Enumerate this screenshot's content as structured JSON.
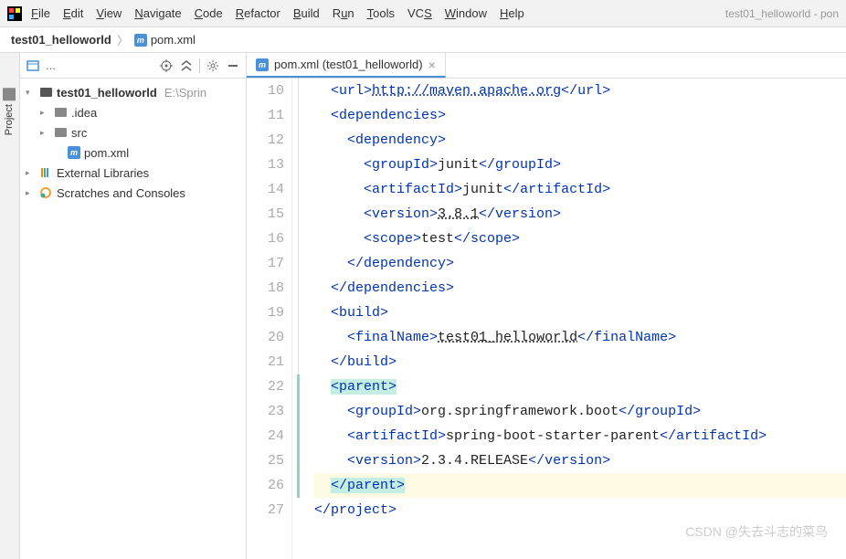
{
  "menu": {
    "items": [
      "File",
      "Edit",
      "View",
      "Navigate",
      "Code",
      "Refactor",
      "Build",
      "Run",
      "Tools",
      "VCS",
      "Window",
      "Help"
    ],
    "underlines": [
      "F",
      "E",
      "V",
      "N",
      "C",
      "R",
      "B",
      "u",
      "T",
      "S",
      "W",
      "H"
    ]
  },
  "window_title": "test01_helloworld - pon",
  "breadcrumb": {
    "project": "test01_helloworld",
    "file": "pom.xml"
  },
  "sidebar_tab": "Project",
  "project_toolbar": {
    "dots": "..."
  },
  "tree": {
    "root": {
      "label": "test01_helloworld",
      "path": "E:\\Sprin"
    },
    "idea": ".idea",
    "src": "src",
    "pom": "pom.xml",
    "external": "External Libraries",
    "scratches": "Scratches and Consoles"
  },
  "tab": {
    "label": "pom.xml (test01_helloworld)"
  },
  "code": {
    "lines": [
      {
        "n": 10,
        "html": "  <span class='tag'>&lt;url&gt;</span><span class='link'>http://maven.apache.org</span><span class='tag'>&lt;/url&gt;</span>"
      },
      {
        "n": 11,
        "html": "  <span class='tag'>&lt;dependencies&gt;</span>"
      },
      {
        "n": 12,
        "html": "    <span class='tag'>&lt;dependency&gt;</span>"
      },
      {
        "n": 13,
        "html": "      <span class='tag'>&lt;groupId&gt;</span><span class='txt'>junit</span><span class='tag'>&lt;/groupId&gt;</span>"
      },
      {
        "n": 14,
        "html": "      <span class='tag'>&lt;artifactId&gt;</span><span class='txt'>junit</span><span class='tag'>&lt;/artifactId&gt;</span>"
      },
      {
        "n": 15,
        "html": "      <span class='tag'>&lt;version&gt;</span><span class='val'>3.8.1</span><span class='tag'>&lt;/version&gt;</span>"
      },
      {
        "n": 16,
        "html": "      <span class='tag'>&lt;scope&gt;</span><span class='txt'>test</span><span class='tag'>&lt;/scope&gt;</span>"
      },
      {
        "n": 17,
        "html": "    <span class='tag'>&lt;/dependency&gt;</span>"
      },
      {
        "n": 18,
        "html": "  <span class='tag'>&lt;/dependencies&gt;</span>"
      },
      {
        "n": 19,
        "html": "  <span class='tag'>&lt;build&gt;</span>"
      },
      {
        "n": 20,
        "html": "    <span class='tag'>&lt;finalName&gt;</span><span class='val'>test01_helloworld</span><span class='tag'>&lt;/finalName&gt;</span>"
      },
      {
        "n": 21,
        "html": "  <span class='tag'>&lt;/build&gt;</span>"
      },
      {
        "n": 22,
        "html": "  <span class='hl-bg'><span class='tag'>&lt;parent&gt;</span></span>"
      },
      {
        "n": 23,
        "html": "    <span class='tag'>&lt;groupId&gt;</span><span class='txt'>org.springframework.boot</span><span class='tag'>&lt;/groupId&gt;</span>"
      },
      {
        "n": 24,
        "html": "    <span class='tag'>&lt;artifactId&gt;</span><span class='txt'>spring-boot-starter-parent</span><span class='tag'>&lt;/artifactId&gt;</span>"
      },
      {
        "n": 25,
        "html": "    <span class='tag'>&lt;version&gt;</span><span class='txt'>2.3.4.RELEASE</span><span class='tag'>&lt;/version&gt;</span>"
      },
      {
        "n": 26,
        "html": "  <span class='hl-bg'><span class='tag'>&lt;/parent&gt;</span></span>",
        "current": true
      },
      {
        "n": 27,
        "html": "<span class='tag'>&lt;/project&gt;</span>"
      }
    ]
  },
  "watermark": "CSDN @失去斗志的菜鸟"
}
